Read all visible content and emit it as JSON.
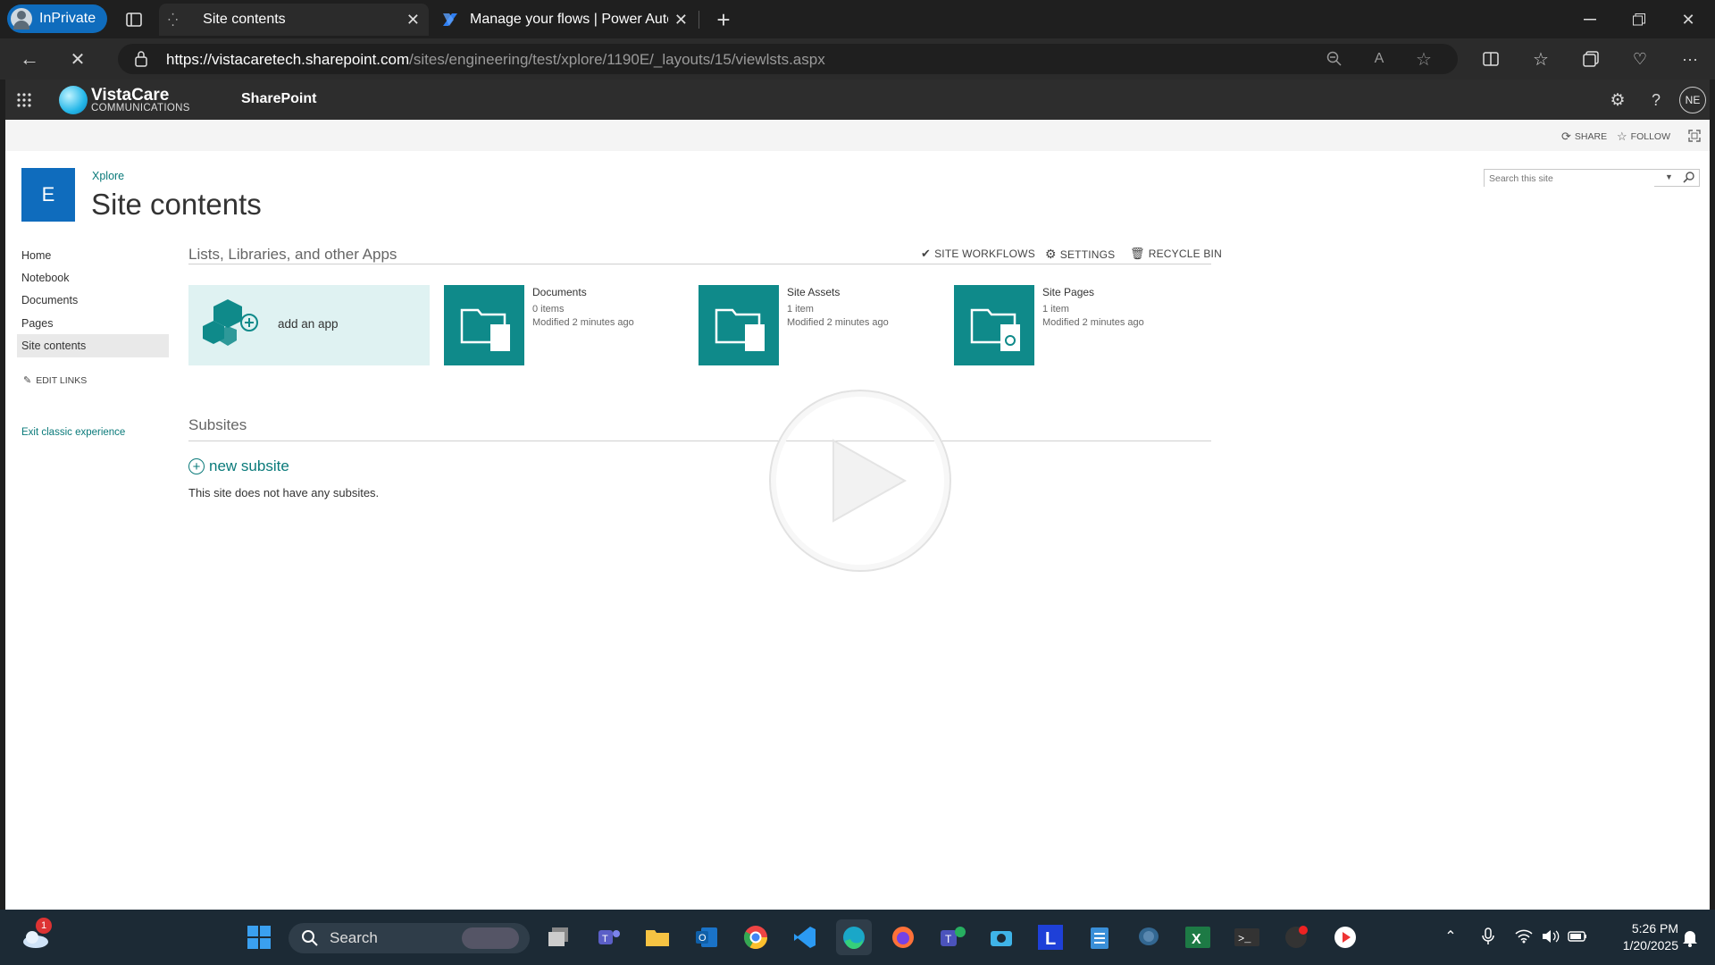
{
  "browser": {
    "profile_label": "InPrivate",
    "tabs": [
      {
        "title": "Site contents",
        "active": true
      },
      {
        "title": "Manage your flows | Power Autom",
        "active": false
      }
    ],
    "url_host": "https://vistacaretech.sharepoint.com",
    "url_path": "/sites/engineering/test/xplore/1190E/_layouts/15/viewlsts.aspx"
  },
  "suite": {
    "brand_top": "VistaCare",
    "brand_bottom": "COMMUNICATIONS",
    "app_name": "SharePoint",
    "avatar_initials": "NE"
  },
  "ribbon": {
    "share": "SHARE",
    "follow": "FOLLOW"
  },
  "site": {
    "logo_letter": "E",
    "breadcrumb": "Xplore",
    "title": "Site contents",
    "search_placeholder": "Search this site"
  },
  "leftnav": {
    "items": [
      "Home",
      "Notebook",
      "Documents",
      "Pages",
      "Site contents"
    ],
    "edit_links": "EDIT LINKS",
    "exit": "Exit classic experience"
  },
  "content": {
    "section_title": "Lists, Libraries, and other Apps",
    "actions": {
      "workflows": "SITE WORKFLOWS",
      "settings": "SETTINGS",
      "recycle": "RECYCLE BIN"
    },
    "add_app": "add an app",
    "apps": [
      {
        "name": "Documents",
        "count": "0 items",
        "modified": "Modified 2 minutes ago"
      },
      {
        "name": "Site Assets",
        "count": "1 item",
        "modified": "Modified 2 minutes ago"
      },
      {
        "name": "Site Pages",
        "count": "1 item",
        "modified": "Modified 2 minutes ago"
      }
    ],
    "subsites_title": "Subsites",
    "new_subsite": "new subsite",
    "no_subsites": "This site does not have any subsites."
  },
  "taskbar": {
    "search_label": "Search",
    "weather_badge": "1",
    "time": "5:26 PM",
    "date": "1/20/2025"
  },
  "colors": {
    "tile": "#0f8a8a",
    "link": "#0a7a7a",
    "suite": "#2d2d2d",
    "accent_blue": "#0f6cbd"
  }
}
